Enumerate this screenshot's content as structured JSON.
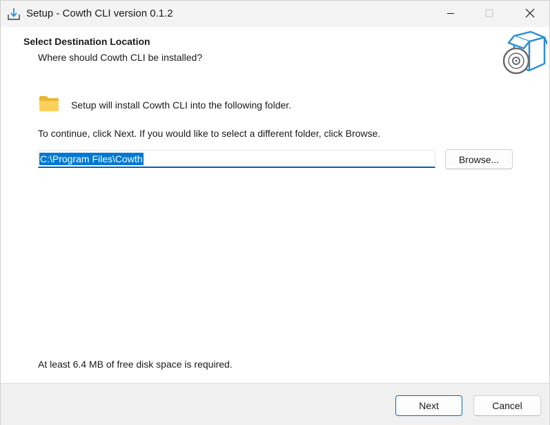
{
  "window": {
    "title": "Setup - Cowth CLI version 0.1.2",
    "controls": {
      "minimize_icon": "minimize-icon",
      "maximize_icon": "maximize-icon",
      "close_icon": "close-icon"
    }
  },
  "header": {
    "title": "Select Destination Location",
    "subtitle": "Where should Cowth CLI be installed?",
    "image_icon": "setup-box-disc-icon"
  },
  "body": {
    "folder_icon": "folder-icon",
    "install_text": "Setup will install Cowth CLI into the following folder.",
    "continue_text": "To continue, click Next. If you would like to select a different folder, click Browse.",
    "path_value": "C:\\Program Files\\Cowth",
    "browse_label": "Browse...",
    "disk_space_text": "At least 6.4 MB of free disk space is required."
  },
  "footer": {
    "next_label": "Next",
    "cancel_label": "Cancel"
  },
  "colors": {
    "accent": "#0078d4",
    "titlebar": "#f3f3f3",
    "footer": "#f0f0f0",
    "folder": "#f8c94a",
    "box_icon": "#2a8fd6"
  }
}
